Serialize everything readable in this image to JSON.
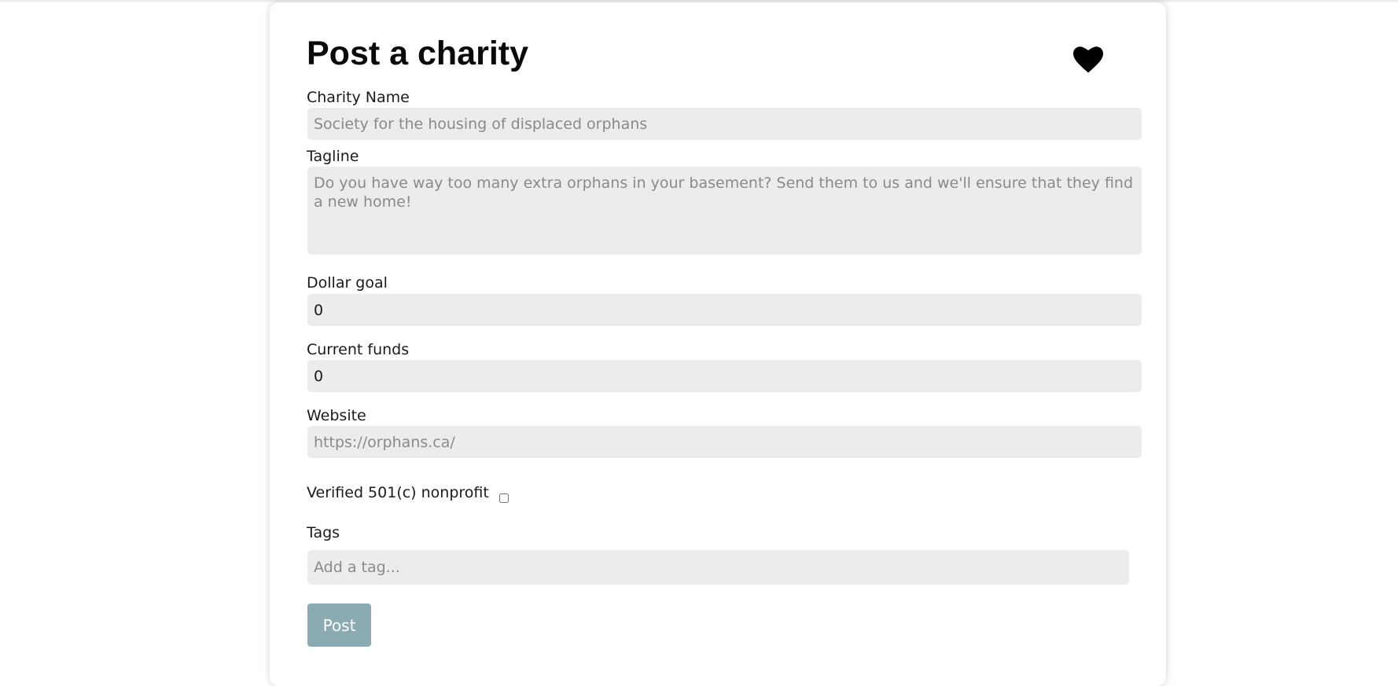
{
  "form": {
    "title": "Post a charity",
    "heart_icon": "heart-icon",
    "fields": {
      "charity_name": {
        "label": "Charity Name",
        "placeholder": "Society for the housing of displaced orphans",
        "value": ""
      },
      "tagline": {
        "label": "Tagline",
        "placeholder": "Do you have way too many extra orphans in your basement? Send them to us and we'll ensure that they find a new home!",
        "value": ""
      },
      "dollar_goal": {
        "label": "Dollar goal",
        "value": "0"
      },
      "current_funds": {
        "label": "Current funds",
        "value": "0"
      },
      "website": {
        "label": "Website",
        "placeholder": "https://orphans.ca/",
        "value": ""
      },
      "verified": {
        "label": "Verified 501(c) nonprofit",
        "checked": false
      },
      "tags": {
        "label": "Tags",
        "placeholder": "Add a tag..."
      }
    },
    "submit_label": "Post"
  },
  "colors": {
    "field_bg": "#ececec",
    "button_bg": "#8aabb1",
    "text": "#111111"
  }
}
